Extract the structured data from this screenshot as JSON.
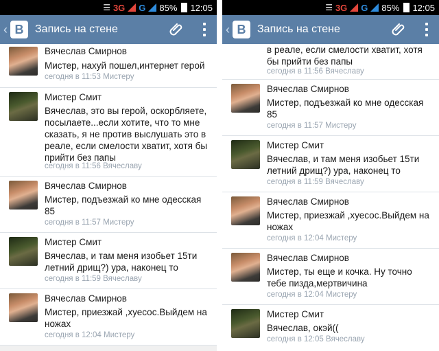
{
  "status": {
    "network": "3G",
    "g": "G",
    "battery": "85%",
    "time": "12:05"
  },
  "appbar": {
    "title": "Запись на стене"
  },
  "left_comments": [
    {
      "author": "Вячеслав Смирнов",
      "text": "Мистер, нахуй пошел,интернет герой",
      "meta": "сегодня в 11:53 Мистеру"
    },
    {
      "author": "Мистер Смит",
      "text": "Вячеслав, это вы герой, оскорбляете, посылаете...если хотите, что то мне сказать, я не против выслушать это в реале, если смелости хватит, хотя бы прийти без папы",
      "meta": "сегодня в 11:56 Вячеславу"
    },
    {
      "author": "Вячеслав Смирнов",
      "text": "Мистер, подъезжай ко мне одесская 85",
      "meta": "сегодня в 11:57 Мистеру"
    },
    {
      "author": "Мистер Смит",
      "text": "Вячеслав, и там меня изобьет 15ти летний дрищ?) ура, наконец то",
      "meta": "сегодня в 11:59 Вячеславу"
    },
    {
      "author": "Вячеслав Смирнов",
      "text": "Мистер, приезжай ,хуесос.Выйдем на ножах",
      "meta": "сегодня в 12:04 Мистеру"
    }
  ],
  "right_partial": {
    "text": "в реале, если смелости хватит, хотя бы прийти без папы",
    "meta": "сегодня в 11:56 Вячеславу"
  },
  "right_comments": [
    {
      "author": "Вячеслав Смирнов",
      "text": "Мистер, подъезжай ко мне одесская 85",
      "meta": "сегодня в 11:57 Мистеру"
    },
    {
      "author": "Мистер Смит",
      "text": "Вячеслав, и там меня изобьет 15ти летний дрищ?) ура, наконец то",
      "meta": "сегодня в 11:59 Вячеславу"
    },
    {
      "author": "Вячеслав Смирнов",
      "text": "Мистер, приезжай ,хуесос.Выйдем на ножах",
      "meta": "сегодня в 12:04 Мистеру"
    },
    {
      "author": "Вячеслав Смирнов",
      "text": "Мистер, ты еще и кочка. Ну точно тебе пизда,мертвичина",
      "meta": "сегодня в 12:04 Мистеру"
    },
    {
      "author": "Мистер Смит",
      "text": "Вячеслав, окэй((",
      "meta": "сегодня в 12:05 Вячеславу"
    }
  ]
}
